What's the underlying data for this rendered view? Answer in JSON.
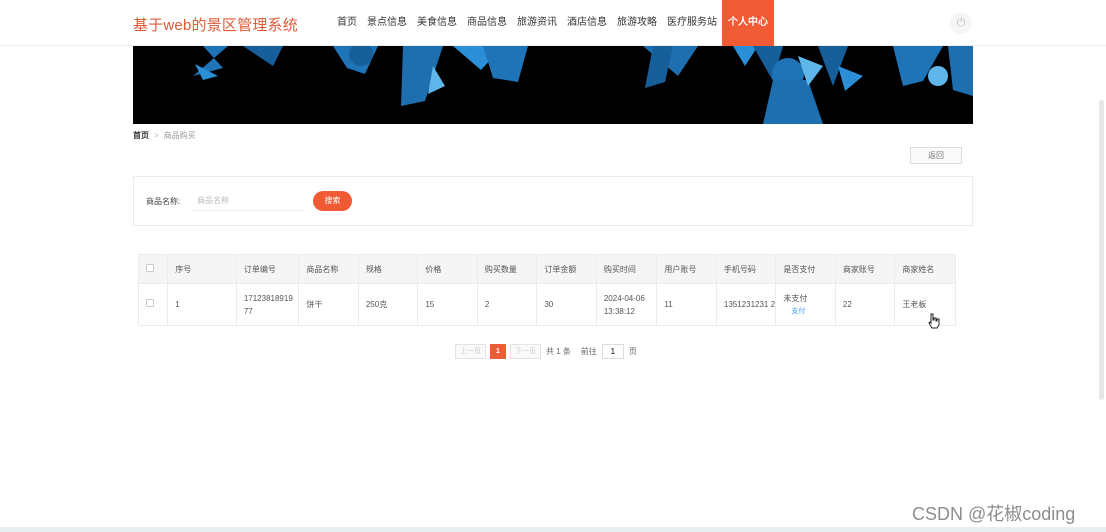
{
  "header": {
    "brand": "基于web的景区管理系统",
    "nav": [
      "首页",
      "景点信息",
      "美食信息",
      "商品信息",
      "旅游资讯",
      "酒店信息",
      "旅游攻略",
      "医疗服务站",
      "个人中心"
    ],
    "power_icon": "power-icon"
  },
  "breadcrumb": {
    "home": "首页",
    "separator": ">",
    "current": "商品购买"
  },
  "back_label": "返回",
  "search": {
    "label": "商品名称:",
    "placeholder": "商品名称",
    "button": "搜索"
  },
  "table": {
    "headers": [
      "序号",
      "订单编号",
      "商品名称",
      "规格",
      "价格",
      "购买数量",
      "订单金额",
      "购买时间",
      "用户账号",
      "手机号码",
      "是否支付",
      "商家账号",
      "商家姓名"
    ],
    "rows": [
      {
        "index": "1",
        "order_no": "17123818919 77",
        "product": "饼干",
        "spec": "250克",
        "price": "15",
        "qty": "2",
        "amount": "30",
        "time_date": "2024-04-06",
        "time_clock": "13:38:12",
        "user_account": "11",
        "phone": "1351231231 2",
        "paid_status": "未支付",
        "pay_action": "支付",
        "merchant_account": "22",
        "merchant_name": "王老板"
      }
    ]
  },
  "pager": {
    "prev": "上一页",
    "page": "1",
    "next": "下一页",
    "total": "共 1 条",
    "goto": "前往",
    "goto_value": "1",
    "page_unit": "页"
  },
  "watermark": "CSDN @花椒coding",
  "colors": {
    "accent": "#f05a34",
    "brand": "#e05a3a",
    "link": "#409eff"
  }
}
